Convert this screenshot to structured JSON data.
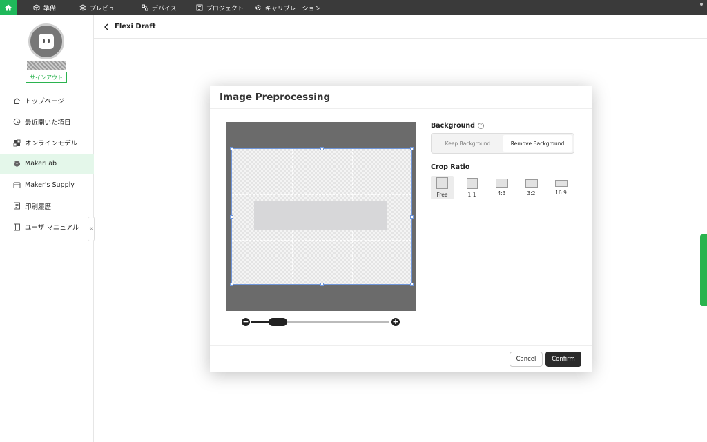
{
  "topbar": {
    "items": [
      {
        "label": "準備",
        "icon": "cube-icon"
      },
      {
        "label": "プレビュー",
        "icon": "layers-icon"
      },
      {
        "label": "デバイス",
        "icon": "devices-icon"
      },
      {
        "label": "プロジェクト",
        "icon": "project-icon"
      },
      {
        "label": "キャリブレーション",
        "icon": "gear-icon"
      }
    ],
    "accent": "#1fb85a"
  },
  "sidebar": {
    "signout_label": "サインアウト",
    "items": [
      {
        "label": "トップページ",
        "icon": "home-icon"
      },
      {
        "label": "最近開いた項目",
        "icon": "clock-icon"
      },
      {
        "label": "オンラインモデル",
        "icon": "models-icon"
      },
      {
        "label": "MakerLab",
        "icon": "makerlab-icon",
        "active": true
      },
      {
        "label": "Maker's Supply",
        "icon": "supply-icon"
      },
      {
        "label": "印刷履歴",
        "icon": "history-icon"
      },
      {
        "label": "ユーザ マニュアル",
        "icon": "manual-icon"
      }
    ],
    "collapse_glyph": "«"
  },
  "header": {
    "title": "Flexi Draft"
  },
  "modal": {
    "title": "Image Preprocessing",
    "background": {
      "label": "Background",
      "help_glyph": "?",
      "options": [
        "Keep Background",
        "Remove Background"
      ],
      "selected": "Remove Background"
    },
    "crop": {
      "label": "Crop Ratio",
      "options": [
        "Free",
        "1:1",
        "4:3",
        "3:2",
        "16:9"
      ],
      "selected": "Free"
    },
    "zoom": {
      "minus": "−",
      "plus": "+",
      "level": 0.19
    },
    "cancel_label": "Cancel",
    "confirm_label": "Confirm"
  }
}
